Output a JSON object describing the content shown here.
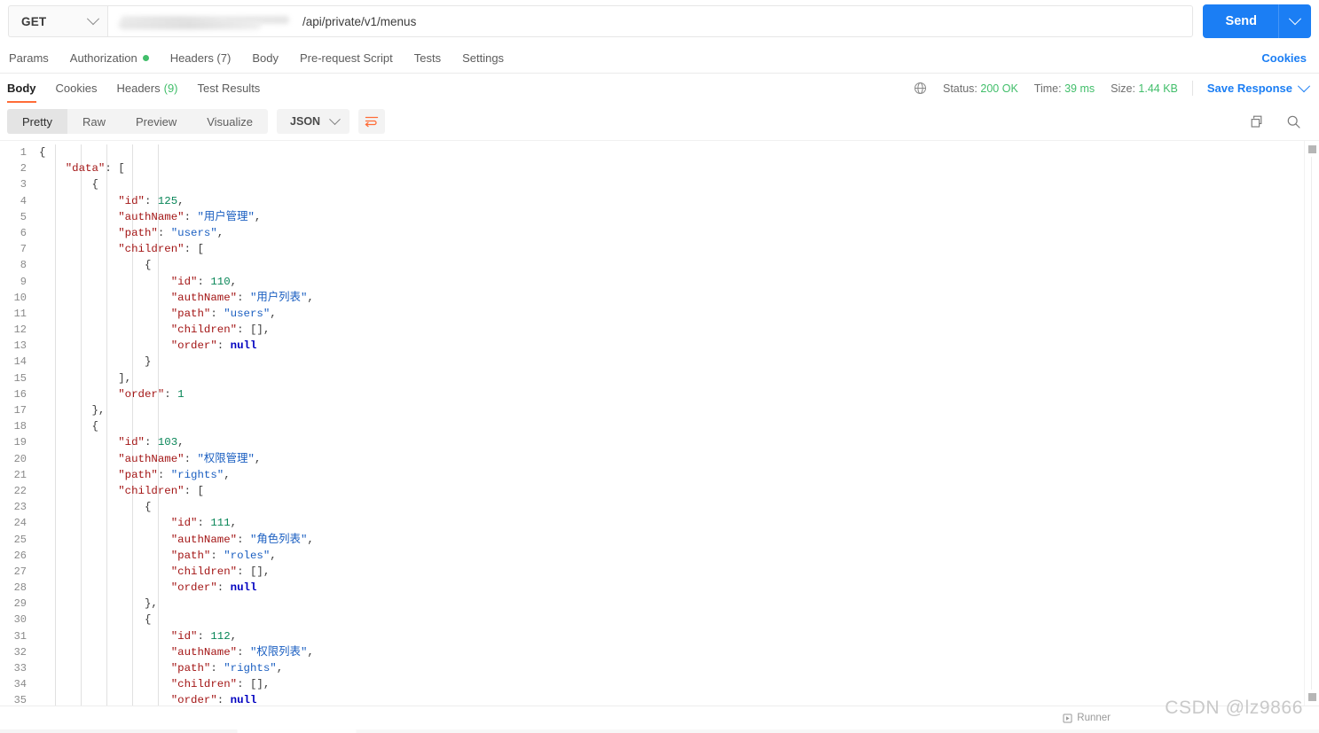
{
  "request": {
    "method": "GET",
    "method_icon": "chevron-down-icon",
    "url_visible": "/api/private/v1/menus",
    "url_redacted": true,
    "send_label": "Send",
    "send_caret_icon": "chevron-down-icon",
    "tabs": [
      {
        "label": "Params",
        "dot": false
      },
      {
        "label": "Authorization",
        "dot": true
      },
      {
        "label": "Headers (7)",
        "dot": false
      },
      {
        "label": "Body",
        "dot": false
      },
      {
        "label": "Pre-request Script",
        "dot": false
      },
      {
        "label": "Tests",
        "dot": false
      },
      {
        "label": "Settings",
        "dot": false
      }
    ],
    "cookies_link": "Cookies"
  },
  "response": {
    "tabs": [
      {
        "label": "Body",
        "active": true,
        "count": ""
      },
      {
        "label": "Cookies",
        "active": false,
        "count": ""
      },
      {
        "label": "Headers",
        "active": false,
        "count": "(9)"
      },
      {
        "label": "Test Results",
        "active": false,
        "count": ""
      }
    ],
    "globe_icon": "globe-icon",
    "status_label": "Status:",
    "status_value": "200 OK",
    "time_label": "Time:",
    "time_value": "39 ms",
    "size_label": "Size:",
    "size_value": "1.44 KB",
    "save_response": "Save Response",
    "save_caret_icon": "chevron-down-icon"
  },
  "format": {
    "modes": [
      {
        "label": "Pretty",
        "active": true
      },
      {
        "label": "Raw",
        "active": false
      },
      {
        "label": "Preview",
        "active": false
      },
      {
        "label": "Visualize",
        "active": false
      }
    ],
    "language": "JSON",
    "language_caret_icon": "chevron-down-icon",
    "wrap_icon": "word-wrap-icon",
    "copy_icon": "copy-icon",
    "search_icon": "search-icon"
  },
  "accent": {
    "brand_blue": "#1B7EF4",
    "active_orange": "#FF6C37",
    "success_green": "#41BE6A",
    "json_key": "#A31515",
    "json_string": "#1B5FC1",
    "json_number": "#098658",
    "json_null": "#0000C0"
  },
  "code": {
    "total_visible_lines": 35,
    "lines": [
      {
        "n": 1,
        "indent": 0,
        "tokens": [
          {
            "t": "{",
            "c": "p"
          }
        ]
      },
      {
        "n": 2,
        "indent": 1,
        "tokens": [
          {
            "t": "\"data\"",
            "c": "k"
          },
          {
            "t": ": [",
            "c": "p"
          }
        ]
      },
      {
        "n": 3,
        "indent": 2,
        "tokens": [
          {
            "t": "{",
            "c": "p"
          }
        ]
      },
      {
        "n": 4,
        "indent": 3,
        "tokens": [
          {
            "t": "\"id\"",
            "c": "k"
          },
          {
            "t": ": ",
            "c": "p"
          },
          {
            "t": "125",
            "c": "n"
          },
          {
            "t": ",",
            "c": "p"
          }
        ]
      },
      {
        "n": 5,
        "indent": 3,
        "tokens": [
          {
            "t": "\"authName\"",
            "c": "k"
          },
          {
            "t": ": ",
            "c": "p"
          },
          {
            "t": "\"用户管理\"",
            "c": "s"
          },
          {
            "t": ",",
            "c": "p"
          }
        ]
      },
      {
        "n": 6,
        "indent": 3,
        "tokens": [
          {
            "t": "\"path\"",
            "c": "k"
          },
          {
            "t": ": ",
            "c": "p"
          },
          {
            "t": "\"users\"",
            "c": "s"
          },
          {
            "t": ",",
            "c": "p"
          }
        ]
      },
      {
        "n": 7,
        "indent": 3,
        "tokens": [
          {
            "t": "\"children\"",
            "c": "k"
          },
          {
            "t": ": [",
            "c": "p"
          }
        ]
      },
      {
        "n": 8,
        "indent": 4,
        "tokens": [
          {
            "t": "{",
            "c": "p"
          }
        ]
      },
      {
        "n": 9,
        "indent": 5,
        "tokens": [
          {
            "t": "\"id\"",
            "c": "k"
          },
          {
            "t": ": ",
            "c": "p"
          },
          {
            "t": "110",
            "c": "n"
          },
          {
            "t": ",",
            "c": "p"
          }
        ]
      },
      {
        "n": 10,
        "indent": 5,
        "tokens": [
          {
            "t": "\"authName\"",
            "c": "k"
          },
          {
            "t": ": ",
            "c": "p"
          },
          {
            "t": "\"用户列表\"",
            "c": "s"
          },
          {
            "t": ",",
            "c": "p"
          }
        ]
      },
      {
        "n": 11,
        "indent": 5,
        "tokens": [
          {
            "t": "\"path\"",
            "c": "k"
          },
          {
            "t": ": ",
            "c": "p"
          },
          {
            "t": "\"users\"",
            "c": "s"
          },
          {
            "t": ",",
            "c": "p"
          }
        ]
      },
      {
        "n": 12,
        "indent": 5,
        "tokens": [
          {
            "t": "\"children\"",
            "c": "k"
          },
          {
            "t": ": [],",
            "c": "p"
          }
        ]
      },
      {
        "n": 13,
        "indent": 5,
        "tokens": [
          {
            "t": "\"order\"",
            "c": "k"
          },
          {
            "t": ": ",
            "c": "p"
          },
          {
            "t": "null",
            "c": "nl"
          }
        ]
      },
      {
        "n": 14,
        "indent": 4,
        "tokens": [
          {
            "t": "}",
            "c": "p"
          }
        ]
      },
      {
        "n": 15,
        "indent": 3,
        "tokens": [
          {
            "t": "],",
            "c": "p"
          }
        ]
      },
      {
        "n": 16,
        "indent": 3,
        "tokens": [
          {
            "t": "\"order\"",
            "c": "k"
          },
          {
            "t": ": ",
            "c": "p"
          },
          {
            "t": "1",
            "c": "n"
          }
        ]
      },
      {
        "n": 17,
        "indent": 2,
        "tokens": [
          {
            "t": "},",
            "c": "p"
          }
        ]
      },
      {
        "n": 18,
        "indent": 2,
        "tokens": [
          {
            "t": "{",
            "c": "p"
          }
        ]
      },
      {
        "n": 19,
        "indent": 3,
        "tokens": [
          {
            "t": "\"id\"",
            "c": "k"
          },
          {
            "t": ": ",
            "c": "p"
          },
          {
            "t": "103",
            "c": "n"
          },
          {
            "t": ",",
            "c": "p"
          }
        ]
      },
      {
        "n": 20,
        "indent": 3,
        "tokens": [
          {
            "t": "\"authName\"",
            "c": "k"
          },
          {
            "t": ": ",
            "c": "p"
          },
          {
            "t": "\"权限管理\"",
            "c": "s"
          },
          {
            "t": ",",
            "c": "p"
          }
        ]
      },
      {
        "n": 21,
        "indent": 3,
        "tokens": [
          {
            "t": "\"path\"",
            "c": "k"
          },
          {
            "t": ": ",
            "c": "p"
          },
          {
            "t": "\"rights\"",
            "c": "s"
          },
          {
            "t": ",",
            "c": "p"
          }
        ]
      },
      {
        "n": 22,
        "indent": 3,
        "tokens": [
          {
            "t": "\"children\"",
            "c": "k"
          },
          {
            "t": ": [",
            "c": "p"
          }
        ]
      },
      {
        "n": 23,
        "indent": 4,
        "tokens": [
          {
            "t": "{",
            "c": "p"
          }
        ]
      },
      {
        "n": 24,
        "indent": 5,
        "tokens": [
          {
            "t": "\"id\"",
            "c": "k"
          },
          {
            "t": ": ",
            "c": "p"
          },
          {
            "t": "111",
            "c": "n"
          },
          {
            "t": ",",
            "c": "p"
          }
        ]
      },
      {
        "n": 25,
        "indent": 5,
        "tokens": [
          {
            "t": "\"authName\"",
            "c": "k"
          },
          {
            "t": ": ",
            "c": "p"
          },
          {
            "t": "\"角色列表\"",
            "c": "s"
          },
          {
            "t": ",",
            "c": "p"
          }
        ]
      },
      {
        "n": 26,
        "indent": 5,
        "tokens": [
          {
            "t": "\"path\"",
            "c": "k"
          },
          {
            "t": ": ",
            "c": "p"
          },
          {
            "t": "\"roles\"",
            "c": "s"
          },
          {
            "t": ",",
            "c": "p"
          }
        ]
      },
      {
        "n": 27,
        "indent": 5,
        "tokens": [
          {
            "t": "\"children\"",
            "c": "k"
          },
          {
            "t": ": [],",
            "c": "p"
          }
        ]
      },
      {
        "n": 28,
        "indent": 5,
        "tokens": [
          {
            "t": "\"order\"",
            "c": "k"
          },
          {
            "t": ": ",
            "c": "p"
          },
          {
            "t": "null",
            "c": "nl"
          }
        ]
      },
      {
        "n": 29,
        "indent": 4,
        "tokens": [
          {
            "t": "},",
            "c": "p"
          }
        ]
      },
      {
        "n": 30,
        "indent": 4,
        "tokens": [
          {
            "t": "{",
            "c": "p"
          }
        ]
      },
      {
        "n": 31,
        "indent": 5,
        "tokens": [
          {
            "t": "\"id\"",
            "c": "k"
          },
          {
            "t": ": ",
            "c": "p"
          },
          {
            "t": "112",
            "c": "n"
          },
          {
            "t": ",",
            "c": "p"
          }
        ]
      },
      {
        "n": 32,
        "indent": 5,
        "tokens": [
          {
            "t": "\"authName\"",
            "c": "k"
          },
          {
            "t": ": ",
            "c": "p"
          },
          {
            "t": "\"权限列表\"",
            "c": "s"
          },
          {
            "t": ",",
            "c": "p"
          }
        ]
      },
      {
        "n": 33,
        "indent": 5,
        "tokens": [
          {
            "t": "\"path\"",
            "c": "k"
          },
          {
            "t": ": ",
            "c": "p"
          },
          {
            "t": "\"rights\"",
            "c": "s"
          },
          {
            "t": ",",
            "c": "p"
          }
        ]
      },
      {
        "n": 34,
        "indent": 5,
        "tokens": [
          {
            "t": "\"children\"",
            "c": "k"
          },
          {
            "t": ": [],",
            "c": "p"
          }
        ]
      },
      {
        "n": 35,
        "indent": 5,
        "tokens": [
          {
            "t": "\"order\"",
            "c": "k"
          },
          {
            "t": ": ",
            "c": "p"
          },
          {
            "t": "null",
            "c": "nl"
          }
        ]
      }
    ]
  },
  "footer": {
    "runner_label": "Runner",
    "runner_icon": "runner-icon",
    "watermark": "CSDN @lz9866"
  }
}
